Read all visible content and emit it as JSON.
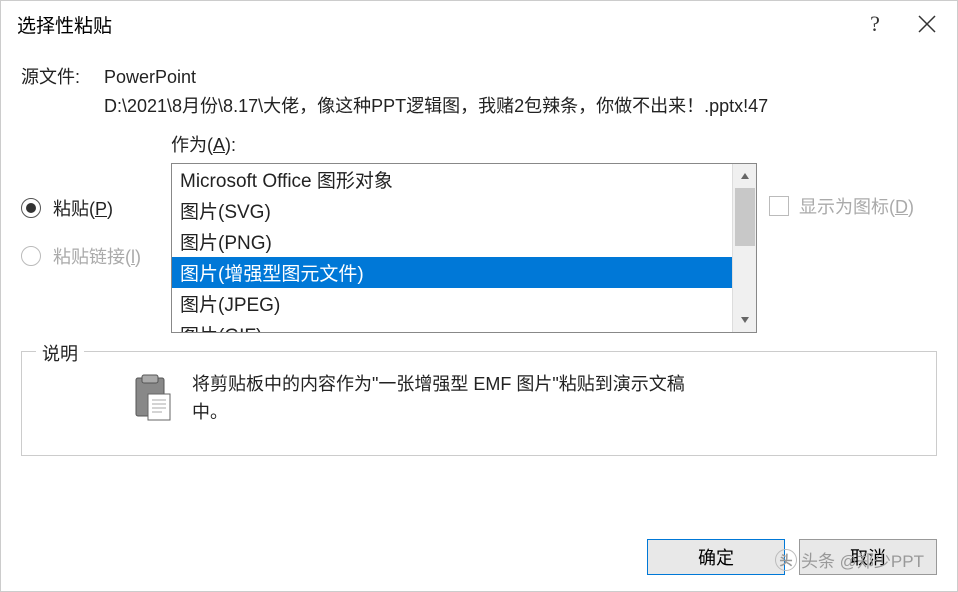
{
  "title": "选择性粘贴",
  "source": {
    "label": "源文件:",
    "app": "PowerPoint",
    "path": "D:\\2021\\8月份\\8.17\\大佬，像这种PPT逻辑图，我赌2包辣条，你做不出来！.pptx!47"
  },
  "as_label": "作为(",
  "as_mn": "A",
  "as_label_end": "):",
  "paste": {
    "label": "粘贴(",
    "mn": "P",
    "end": ")"
  },
  "paste_link": {
    "label": "粘贴链接(",
    "mn": "l",
    "end": ")"
  },
  "list": {
    "items": {
      "0": "Microsoft Office 图形对象",
      "1": "图片(SVG)",
      "2": "图片(PNG)",
      "3": "图片(增强型图元文件)",
      "4": "图片(JPEG)",
      "5": "图片(GIF)"
    }
  },
  "show_as_icon": {
    "label": "显示为图标(",
    "mn": "D",
    "end": ")"
  },
  "description": {
    "legend": "说明",
    "text": "将剪贴板中的内容作为\"一张增强型 EMF 图片\"粘贴到演示文稿中。"
  },
  "buttons": {
    "ok": "确定",
    "cancel": "取消"
  },
  "watermark": "头条 @郑少PPT"
}
